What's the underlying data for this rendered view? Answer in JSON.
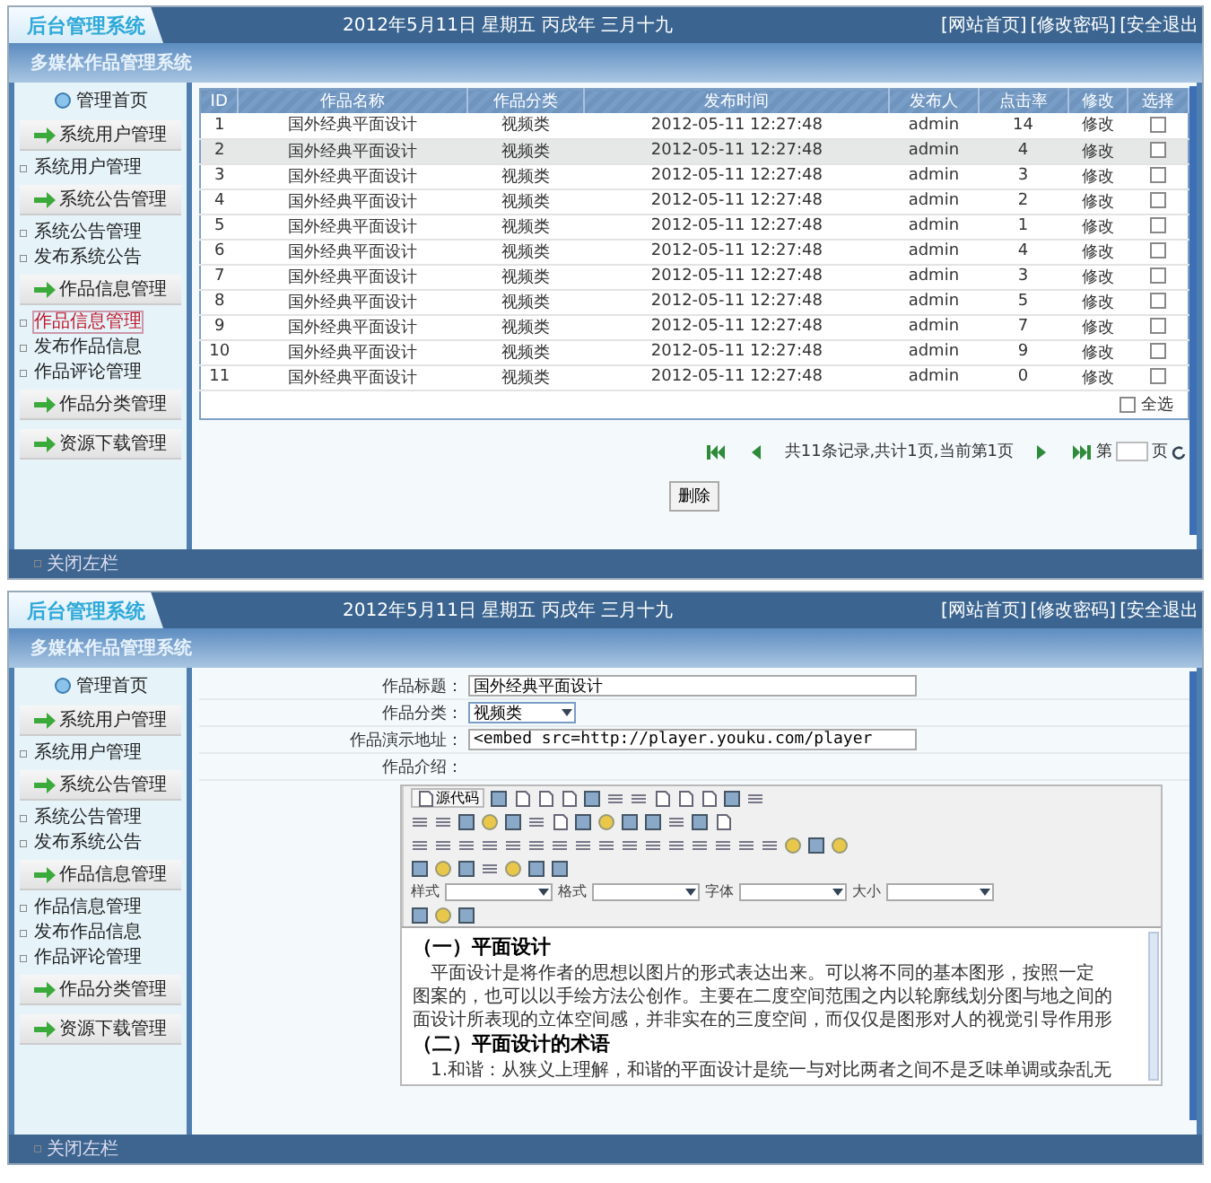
{
  "screens": [
    {
      "kind": "list",
      "header": {
        "logo": "后台管理系统",
        "date": "2012年5月11日 星期五 丙戌年 三月十九",
        "links": [
          "[网站首页]",
          "[修改密码]",
          "[安全退出"
        ]
      },
      "system_title": "多媒体作品管理系统",
      "sidebar": {
        "home": "管理首页",
        "groups": [
          {
            "title": "系统用户管理",
            "items": [
              {
                "label": "系统用户管理",
                "selected": false
              }
            ]
          },
          {
            "title": "系统公告管理",
            "items": [
              {
                "label": "系统公告管理",
                "selected": false
              },
              {
                "label": "发布系统公告",
                "selected": false
              }
            ]
          },
          {
            "title": "作品信息管理",
            "items": [
              {
                "label": "作品信息管理",
                "selected": true
              },
              {
                "label": "发布作品信息",
                "selected": false
              },
              {
                "label": "作品评论管理",
                "selected": false
              }
            ]
          },
          {
            "title": "作品分类管理"
          },
          {
            "title": "资源下载管理"
          }
        ]
      },
      "table": {
        "columns": [
          "ID",
          "作品名称",
          "作品分类",
          "发布时间",
          "发布人",
          "点击率",
          "修改",
          "选择"
        ],
        "rows": [
          {
            "cells": [
              "1",
              "国外经典平面设计",
              "视频类",
              "2012-05-11 12:27:48",
              "admin",
              "14",
              "修改"
            ],
            "hovered": false,
            "checked": false
          },
          {
            "cells": [
              "2",
              "国外经典平面设计",
              "视频类",
              "2012-05-11 12:27:48",
              "admin",
              "4",
              "修改"
            ],
            "hovered": true,
            "checked": false
          },
          {
            "cells": [
              "3",
              "国外经典平面设计",
              "视频类",
              "2012-05-11 12:27:48",
              "admin",
              "3",
              "修改"
            ],
            "hovered": false,
            "checked": false
          },
          {
            "cells": [
              "4",
              "国外经典平面设计",
              "视频类",
              "2012-05-11 12:27:48",
              "admin",
              "2",
              "修改"
            ],
            "hovered": false,
            "checked": false
          },
          {
            "cells": [
              "5",
              "国外经典平面设计",
              "视频类",
              "2012-05-11 12:27:48",
              "admin",
              "1",
              "修改"
            ],
            "hovered": false,
            "checked": false
          },
          {
            "cells": [
              "6",
              "国外经典平面设计",
              "视频类",
              "2012-05-11 12:27:48",
              "admin",
              "4",
              "修改"
            ],
            "hovered": false,
            "checked": false
          },
          {
            "cells": [
              "7",
              "国外经典平面设计",
              "视频类",
              "2012-05-11 12:27:48",
              "admin",
              "3",
              "修改"
            ],
            "hovered": false,
            "checked": false
          },
          {
            "cells": [
              "8",
              "国外经典平面设计",
              "视频类",
              "2012-05-11 12:27:48",
              "admin",
              "5",
              "修改"
            ],
            "hovered": false,
            "checked": false
          },
          {
            "cells": [
              "9",
              "国外经典平面设计",
              "视频类",
              "2012-05-11 12:27:48",
              "admin",
              "7",
              "修改"
            ],
            "hovered": false,
            "checked": false
          },
          {
            "cells": [
              "10",
              "国外经典平面设计",
              "视频类",
              "2012-05-11 12:27:48",
              "admin",
              "9",
              "修改"
            ],
            "hovered": false,
            "checked": false
          },
          {
            "cells": [
              "11",
              "国外经典平面设计",
              "视频类",
              "2012-05-11 12:27:48",
              "admin",
              "0",
              "修改"
            ],
            "hovered": false,
            "checked": false
          }
        ],
        "select_all": {
          "label": "全选",
          "checked": false
        }
      },
      "pagination": {
        "summary": "共11条记录,共计1页,当前第1页",
        "page_prefix": "第",
        "page_suffix": "页"
      },
      "delete_button": "删除",
      "footer": "关闭左栏"
    },
    {
      "kind": "form",
      "header": {
        "logo": "后台管理系统",
        "date": "2012年5月11日 星期五 丙戌年 三月十九",
        "links": [
          "[网站首页]",
          "[修改密码]",
          "[安全退出"
        ]
      },
      "system_title": "多媒体作品管理系统",
      "sidebar": {
        "home": "管理首页",
        "groups": [
          {
            "title": "系统用户管理",
            "items": [
              {
                "label": "系统用户管理",
                "selected": false
              }
            ]
          },
          {
            "title": "系统公告管理",
            "items": [
              {
                "label": "系统公告管理",
                "selected": false
              },
              {
                "label": "发布系统公告",
                "selected": false
              }
            ]
          },
          {
            "title": "作品信息管理",
            "items": [
              {
                "label": "作品信息管理",
                "selected": false
              },
              {
                "label": "发布作品信息",
                "selected": false
              },
              {
                "label": "作品评论管理",
                "selected": false
              }
            ]
          },
          {
            "title": "作品分类管理"
          },
          {
            "title": "资源下载管理"
          }
        ]
      },
      "form": {
        "fields": [
          {
            "kind": "text",
            "label": "作品标题：",
            "value": "国外经典平面设计"
          },
          {
            "kind": "select",
            "label": "作品分类：",
            "value": "视频类"
          },
          {
            "kind": "text",
            "label": "作品演示地址：",
            "value": "<embed src=http://player.youku.com/player"
          },
          {
            "kind": "editor",
            "label": "作品介绍："
          }
        ],
        "editor": {
          "source_button": "源代码",
          "dropdowns": [
            "样式",
            "格式",
            "字体",
            "大小"
          ],
          "content": [
            {
              "kind": "heading",
              "text": "（一）平面设计"
            },
            {
              "kind": "line",
              "text": "平面设计是将作者的思想以图片的形式表达出来。可以将不同的基本图形，按照一定"
            },
            {
              "kind": "line",
              "text": "图案的，也可以以手绘方法公创作。主要在二度空间范围之内以轮廓线划分图与地之间的"
            },
            {
              "kind": "line",
              "text": "面设计所表现的立体空间感，并非实在的三度空间，而仅仅是图形对人的视觉引导作用形"
            },
            {
              "kind": "heading",
              "text": "（二）平面设计的术语"
            },
            {
              "kind": "line",
              "text": "1.和谐：从狭义上理解，和谐的平面设计是统一与对比两者之间不是乏味单调或杂乱无"
            }
          ]
        }
      },
      "footer": "关闭左栏"
    }
  ]
}
